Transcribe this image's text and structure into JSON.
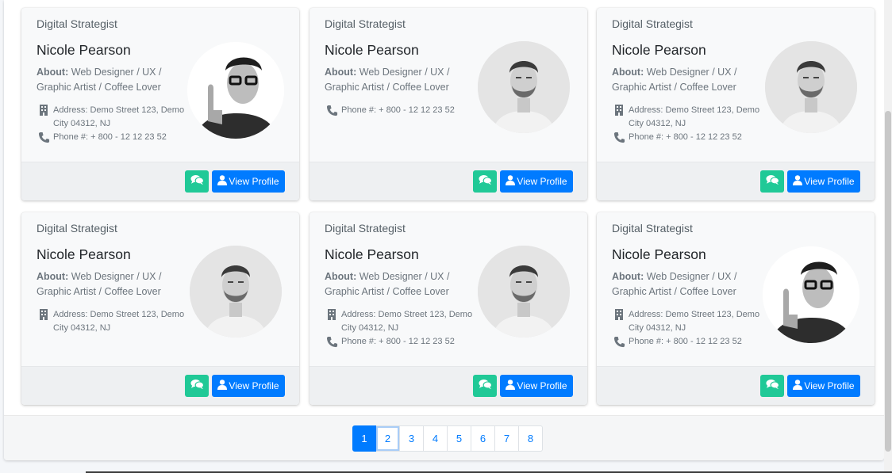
{
  "colors": {
    "primary": "#007bff",
    "chat": "#20c997"
  },
  "cards": [
    {
      "role": "Digital Strategist",
      "name": "Nicole Pearson",
      "about_label": "About:",
      "about_text": "Web Designer / UX / Graphic Artist / Coffee Lover",
      "address": "Address: Demo Street 123, Demo City 04312, NJ",
      "phone": "Phone #: + 800 - 12 12 23 52",
      "avatar": "glasses-photo",
      "chat_icon": "comments-icon",
      "view_label": "View Profile"
    },
    {
      "role": "Digital Strategist",
      "name": "Nicole Pearson",
      "about_label": "About:",
      "about_text": "Web Designer / UX / Graphic Artist / Coffee Lover",
      "phone": "Phone #: + 800 - 12 12 23 52",
      "avatar": "bearded-photo",
      "chat_icon": "comments-icon",
      "view_label": "View Profile"
    },
    {
      "role": "Digital Strategist",
      "name": "Nicole Pearson",
      "about_label": "About:",
      "about_text": "Web Designer / UX / Graphic Artist / Coffee Lover",
      "address": "Address: Demo Street 123, Demo City 04312, NJ",
      "phone": "Phone #: + 800 - 12 12 23 52",
      "avatar": "bearded-photo",
      "chat_icon": "comments-icon",
      "view_label": "View Profile"
    },
    {
      "role": "Digital Strategist",
      "name": "Nicole Pearson",
      "about_label": "About:",
      "about_text": "Web Designer / UX / Graphic Artist / Coffee Lover",
      "address": "Address: Demo Street 123, Demo City 04312, NJ",
      "avatar": "bearded-photo",
      "chat_icon": "comments-icon",
      "view_label": "View Profile"
    },
    {
      "role": "Digital Strategist",
      "name": "Nicole Pearson",
      "about_label": "About:",
      "about_text": "Web Designer / UX / Graphic Artist / Coffee Lover",
      "address": "Address: Demo Street 123, Demo City 04312, NJ",
      "phone": "Phone #: + 800 - 12 12 23 52",
      "avatar": "bearded-photo",
      "chat_icon": "comments-icon",
      "view_label": "View Profile"
    },
    {
      "role": "Digital Strategist",
      "name": "Nicole Pearson",
      "about_label": "About:",
      "about_text": "Web Designer / UX / Graphic Artist / Coffee Lover",
      "address": "Address: Demo Street 123, Demo City 04312, NJ",
      "phone": "Phone #: + 800 - 12 12 23 52",
      "avatar": "glasses-photo",
      "chat_icon": "comments-icon",
      "view_label": "View Profile"
    }
  ],
  "pagination": {
    "pages": [
      "1",
      "2",
      "3",
      "4",
      "5",
      "6",
      "7",
      "8"
    ],
    "active": "1",
    "focused": "2"
  }
}
